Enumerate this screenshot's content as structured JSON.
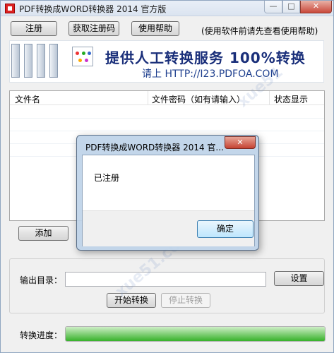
{
  "window": {
    "title": "PDF转换成WORD转换器 2014 官方版",
    "controls": {
      "minimize": "—",
      "maximize": "□",
      "close": "✕"
    }
  },
  "toolbar": {
    "register_label": "注册",
    "get_code_label": "获取注册码",
    "help_label": "使用帮助",
    "hint": "(使用软件前请先查看使用帮助)"
  },
  "banner": {
    "headline": "提供人工转换服务 100%转换",
    "subline": "请上  HTTP://I23.PDFOA.COM"
  },
  "file_list": {
    "columns": [
      "文件名",
      "文件密码（如有请输入）",
      "状态显示"
    ],
    "rows": []
  },
  "buttons": {
    "add_label": "添加",
    "browse_label": "设置",
    "start_label": "开始转换",
    "stop_label": "停止转换"
  },
  "output": {
    "label": "输出目录：",
    "value": ""
  },
  "progress": {
    "label": "转换进度：",
    "value_fraction": 1.0
  },
  "dialog": {
    "title": "PDF转换成WORD转换器 2014 官...",
    "message": "已注册",
    "ok_label": "确定",
    "close": "✕"
  },
  "colors": {
    "banner_text": "#1a2f7a",
    "progress_fill": "#37b12a",
    "close_button": "#c9483a"
  }
}
